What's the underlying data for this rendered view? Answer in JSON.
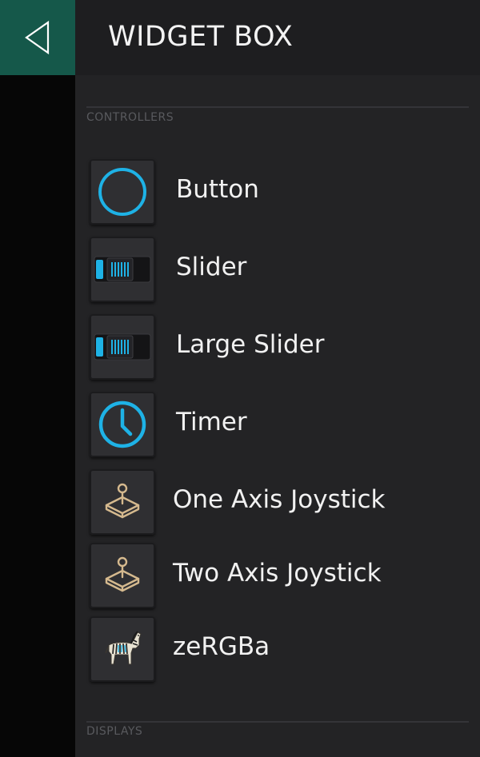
{
  "header": {
    "title": "WIDGET BOX"
  },
  "sections": {
    "controllers": "CONTROLLERS",
    "displays": "DISPLAYS"
  },
  "widgets": [
    {
      "label": "Button",
      "icon": "ring-icon"
    },
    {
      "label": "Slider",
      "icon": "slider-icon"
    },
    {
      "label": "Large Slider",
      "icon": "large-slider-icon"
    },
    {
      "label": "Timer",
      "icon": "clock-icon"
    },
    {
      "label": "One Axis Joystick",
      "icon": "joystick-icon"
    },
    {
      "label": "Two Axis Joystick",
      "icon": "joystick-icon"
    },
    {
      "label": "zeRGBa",
      "icon": "zebra-icon"
    }
  ],
  "colors": {
    "accent_blue": "#1eb2e6",
    "back_green": "#15584a",
    "joystick_tan": "#d5b98e"
  }
}
